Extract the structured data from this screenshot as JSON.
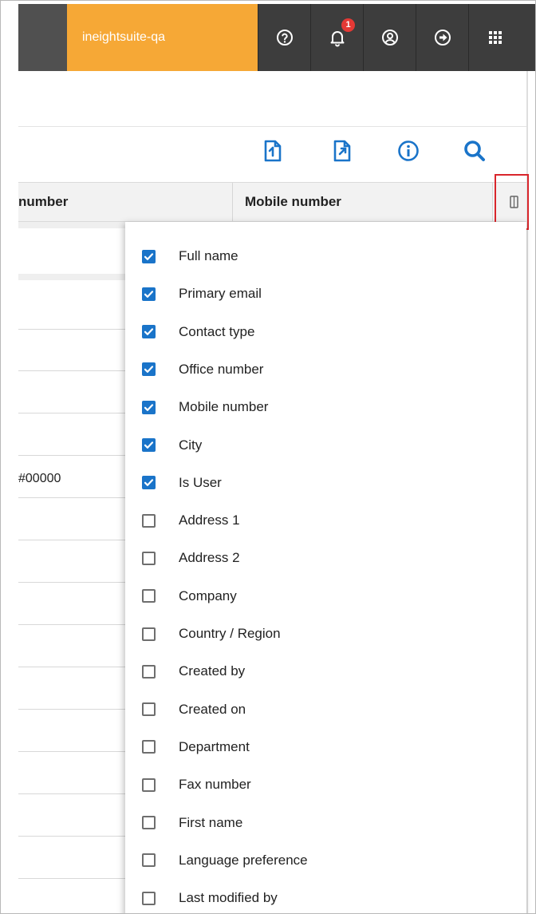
{
  "topbar": {
    "environment": "ineightsuite-qa",
    "notification_count": "1",
    "icons": [
      "help-icon",
      "bell-icon",
      "user-icon",
      "logout-icon",
      "apps-grid-icon"
    ]
  },
  "toolbar": {
    "icons": [
      "import-icon",
      "export-icon",
      "info-icon",
      "search-icon"
    ],
    "accent": "#1a74c9"
  },
  "grid": {
    "columns": [
      "number",
      "Mobile number"
    ],
    "visible_cell": "#00000"
  },
  "column_chooser": {
    "options": [
      {
        "label": "Full name",
        "checked": true
      },
      {
        "label": "Primary email",
        "checked": true
      },
      {
        "label": "Contact type",
        "checked": true
      },
      {
        "label": "Office number",
        "checked": true
      },
      {
        "label": "Mobile number",
        "checked": true
      },
      {
        "label": "City",
        "checked": true
      },
      {
        "label": "Is User",
        "checked": true
      },
      {
        "label": "Address 1",
        "checked": false
      },
      {
        "label": "Address 2",
        "checked": false
      },
      {
        "label": "Company",
        "checked": false
      },
      {
        "label": "Country / Region",
        "checked": false
      },
      {
        "label": "Created by",
        "checked": false
      },
      {
        "label": "Created on",
        "checked": false
      },
      {
        "label": "Department",
        "checked": false
      },
      {
        "label": "Fax number",
        "checked": false
      },
      {
        "label": "First name",
        "checked": false
      },
      {
        "label": "Language preference",
        "checked": false
      },
      {
        "label": "Last modified by",
        "checked": false
      }
    ]
  },
  "colors": {
    "env_bg": "#f6a836",
    "nav_bg": "#3d3d3d",
    "highlight": "#d9262c"
  }
}
